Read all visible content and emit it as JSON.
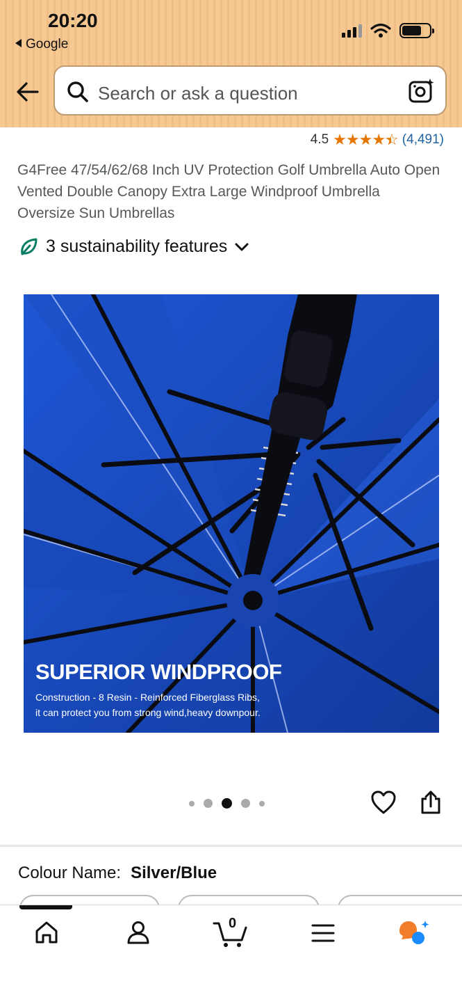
{
  "status_bar": {
    "time": "20:20",
    "back_app": "Google"
  },
  "search": {
    "placeholder": "Search or ask a question"
  },
  "product": {
    "rating": "4.5",
    "review_count": "(4,491)",
    "title": "G4Free 47/54/62/68 Inch UV Protection Golf Umbrella Auto Open Vented Double Canopy Extra Large Windproof Umbrella Oversize Sun Umbrellas",
    "sustainability": "3 sustainability features",
    "image": {
      "headline": "SUPERIOR WINDPROOF",
      "caption_line1": "Construction - 8 Resin - Reinforced Fiberglass Ribs,",
      "caption_line2": "it can protect you from strong wind,heavy downpour."
    },
    "carousel": {
      "total": 5,
      "active_index": 2
    },
    "colour_label": "Colour Name:",
    "colour_value": "Silver/Blue"
  },
  "bottom_nav": {
    "items": [
      "home-icon",
      "account-icon",
      "cart-icon",
      "menu-icon",
      "rufus-icon"
    ],
    "cart_count": "0"
  },
  "colors": {
    "header": "#f6c892",
    "star": "#e77600",
    "link": "#2162a1",
    "canopy": "#1a4fc5",
    "sustain_leaf": "#067d62"
  }
}
